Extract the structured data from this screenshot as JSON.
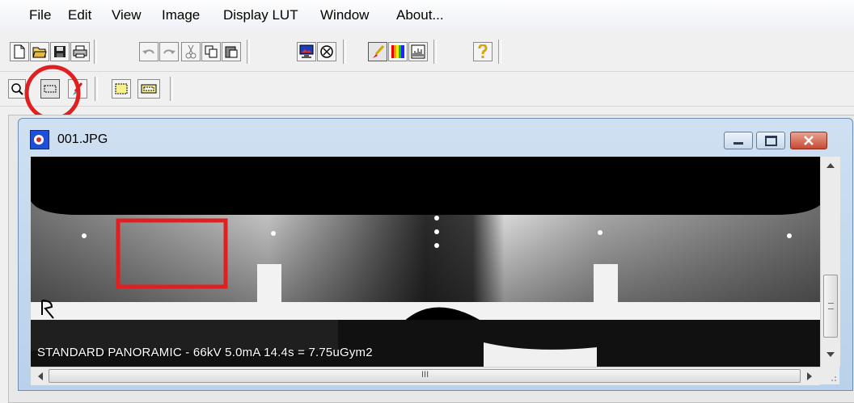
{
  "menu": {
    "items": [
      "File",
      "Edit",
      "View",
      "Image",
      "Display LUT",
      "Window",
      "About..."
    ]
  },
  "toolbar1": {
    "buttons": [
      "new-document-icon",
      "open-folder-icon",
      "save-disk-icon",
      "print-icon",
      "undo-icon",
      "redo-icon",
      "cut-icon",
      "copy-icon",
      "paste-icon",
      "monitor-display-icon",
      "cancel-circle-icon",
      "brush-icon",
      "lut-colors-icon",
      "histogram-icon",
      "help-question-icon"
    ]
  },
  "toolbar2": {
    "buttons": [
      "zoom-magnifier-icon",
      "rectangle-select-icon",
      "pen-annotate-icon",
      "yellow-roi-icon",
      "yellow-frame-icon"
    ]
  },
  "document": {
    "title": "001.JPG",
    "caption": "STANDARD PANORAMIC - 66kV 5.0mA 14.4s = 7.75uGym2",
    "scroll_mid_label": "III"
  },
  "colors": {
    "highlight_red": "#e02020",
    "title_bar": "#c9dcf0",
    "close_button": "#d9534f"
  }
}
